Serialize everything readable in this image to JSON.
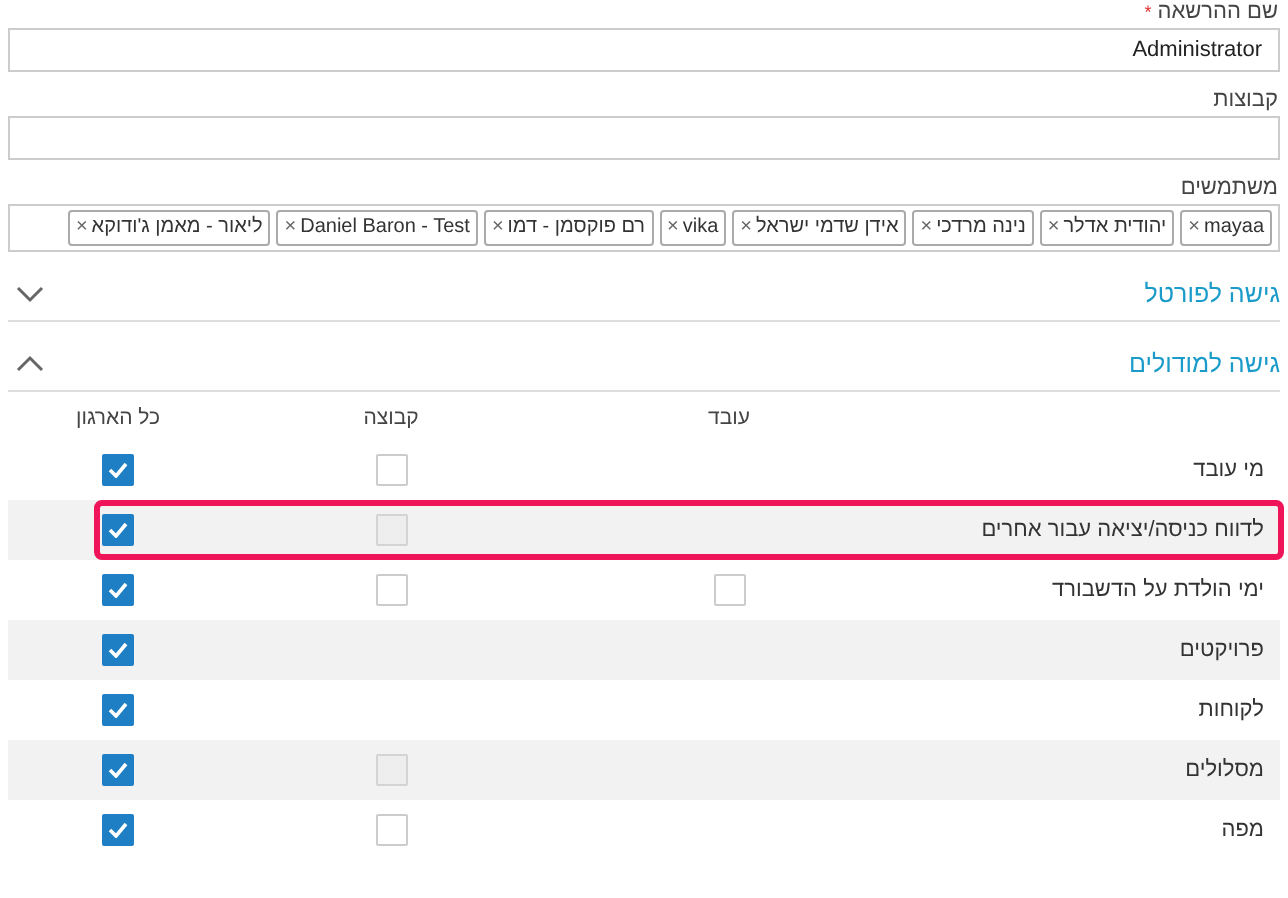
{
  "permission_name": {
    "label": "שם ההרשאה",
    "required_mark": "*",
    "value": "Administrator"
  },
  "groups": {
    "label": "קבוצות"
  },
  "users": {
    "label": "משתמשים",
    "tags": [
      "mayaa",
      "יהודית אדלר",
      "נינה מרדכי",
      "אידן שדמי ישראל",
      "vika",
      "רם פוקסמן - דמו",
      "Daniel Baron - Test",
      "ליאור - מאמן ג'ודוקא"
    ],
    "remove_mark": "×"
  },
  "sections": [
    {
      "title": "גישה לפורטל",
      "expanded": false
    },
    {
      "title": "גישה למודולים",
      "expanded": true
    }
  ],
  "table": {
    "columns": [
      "עובד",
      "קבוצה",
      "כל הארגון"
    ],
    "rows": [
      {
        "name": "מי עובד",
        "highlighted": false,
        "cells": [
          null,
          {
            "checked": false,
            "disabled": false
          },
          {
            "checked": true
          }
        ]
      },
      {
        "name": "לדווח כניסה/יציאה עבור אחרים",
        "highlighted": true,
        "cells": [
          null,
          {
            "checked": false,
            "disabled": true
          },
          {
            "checked": true
          }
        ]
      },
      {
        "name": "ימי הולדת על הדשבורד",
        "highlighted": false,
        "cells": [
          {
            "checked": false
          },
          {
            "checked": false,
            "disabled": false
          },
          {
            "checked": true
          }
        ]
      },
      {
        "name": "פרויקטים",
        "highlighted": false,
        "cells": [
          null,
          null,
          {
            "checked": true
          }
        ]
      },
      {
        "name": "לקוחות",
        "highlighted": false,
        "cells": [
          null,
          null,
          {
            "checked": true
          }
        ]
      },
      {
        "name": "מסלולים",
        "highlighted": false,
        "cells": [
          null,
          {
            "checked": false,
            "disabled": true
          },
          {
            "checked": true
          }
        ]
      },
      {
        "name": "מפה",
        "highlighted": false,
        "cells": [
          null,
          {
            "checked": false,
            "disabled": false
          },
          {
            "checked": true
          }
        ]
      }
    ]
  }
}
